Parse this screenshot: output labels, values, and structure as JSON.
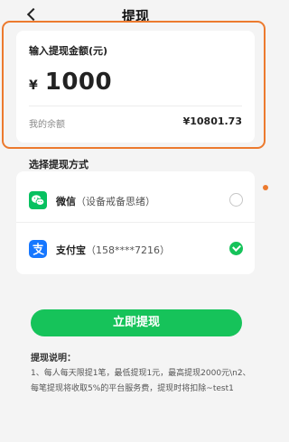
{
  "header": {
    "back_icon": "chevron-left-icon",
    "title": "提现"
  },
  "amount_card": {
    "label": "输入提现金额(元)",
    "currency_symbol": "¥",
    "amount": "1000",
    "balance_label": "我的余额",
    "balance_value": "¥10801.73"
  },
  "payment": {
    "section_title": "选择提现方式",
    "methods": [
      {
        "icon": "wechat-icon",
        "name": "微信",
        "detail": "（设备戒备思绪）",
        "selected": false
      },
      {
        "icon": "alipay-icon",
        "name": "支付宝",
        "detail": "（158****7216）",
        "selected": true
      }
    ]
  },
  "submit_label": "立即提现",
  "notes": {
    "title": "提现说明：",
    "lines": [
      "1、每人每天限提1笔，最低提现1元，最高提现2000元\\n2、",
      "每笔提现将收取5%的平台服务费，提现时将扣除~test1"
    ]
  },
  "colors": {
    "accent_green": "#16c35a",
    "highlight_orange": "#ec7a2e",
    "wechat_green": "#07c160",
    "alipay_blue": "#1677ff"
  }
}
